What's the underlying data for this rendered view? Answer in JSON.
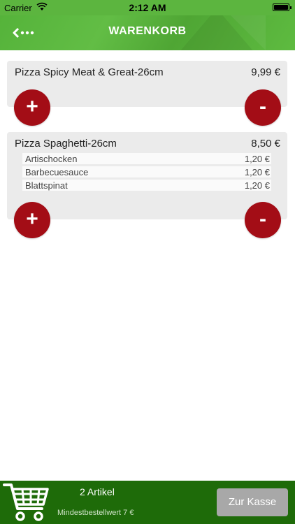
{
  "status_bar": {
    "carrier": "Carrier",
    "time": "2:12 AM"
  },
  "nav": {
    "title": "WARENKORB",
    "back_icon": "back-arrow-dots-icon"
  },
  "cart": {
    "items": [
      {
        "name": "Pizza Spicy Meat & Great-26cm",
        "price": "9,99 €",
        "extras": [],
        "add_label": "+",
        "remove_label": "-"
      },
      {
        "name": "Pizza Spaghetti-26cm",
        "price": "8,50 €",
        "extras": [
          {
            "name": "Artischocken",
            "price": "1,20 €"
          },
          {
            "name": "Barbecuesauce",
            "price": "1,20 €"
          },
          {
            "name": "Blattspinat",
            "price": "1,20 €"
          }
        ],
        "add_label": "+",
        "remove_label": "-"
      }
    ]
  },
  "footer": {
    "article_count": "2 Artikel",
    "min_order": "Mindestbestellwert 7 €",
    "checkout_label": "Zur Kasse",
    "cart_icon": "shopping-cart-icon"
  },
  "colors": {
    "header_green": "#5cb53f",
    "button_red": "#a30d16",
    "footer_green": "#1e6b09",
    "checkout_gray": "#a8a8a8"
  }
}
